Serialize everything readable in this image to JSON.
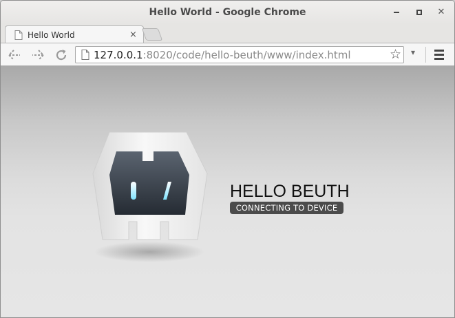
{
  "window": {
    "title": "Hello World - Google Chrome",
    "controls": [
      "minimize-icon",
      "maximize-icon",
      "close-icon"
    ]
  },
  "tabs": [
    {
      "label": "Hello World",
      "active": true,
      "icon": "page-icon",
      "close_glyph": "×"
    }
  ],
  "toolbar": {
    "url_host": "127.0.0.1",
    "url_path": ":8020/code/hello-beuth/www/index.html",
    "icons": [
      "back-arrow-icon",
      "forward-arrow-icon",
      "reload-icon",
      "star-icon",
      "dropdown-icon",
      "menu-icon"
    ],
    "star_glyph": "☆",
    "dropdown_glyph": "▾"
  },
  "app": {
    "title": "HELLO BEUTH",
    "status": "CONNECTING TO DEVICE",
    "logo_icon": "cordova-robot-icon"
  },
  "colors": {
    "badge_bg": "#4b4b4b",
    "content_gradient_top": "#a9a9a9",
    "content_gradient_bottom": "#e6e6e6"
  }
}
